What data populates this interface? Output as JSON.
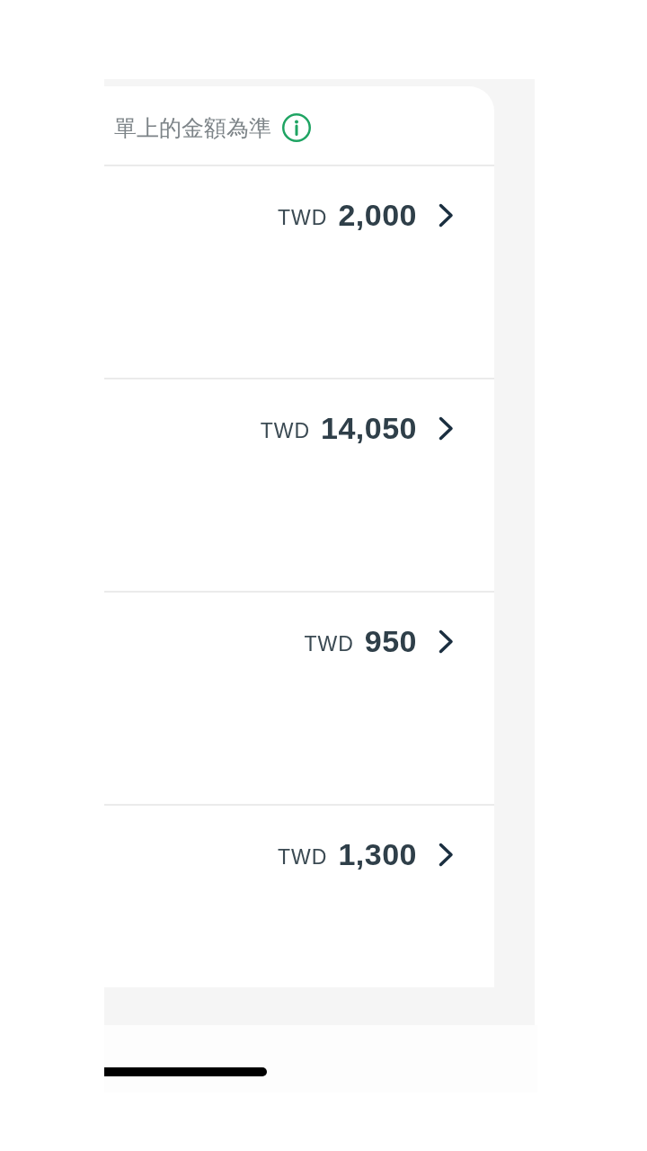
{
  "notice": {
    "text": "單上的金額為準"
  },
  "items": [
    {
      "currency": "TWD",
      "amount": "2,000"
    },
    {
      "currency": "TWD",
      "amount": "14,050"
    },
    {
      "currency": "TWD",
      "amount": "950"
    },
    {
      "currency": "TWD",
      "amount": "1,300"
    }
  ]
}
